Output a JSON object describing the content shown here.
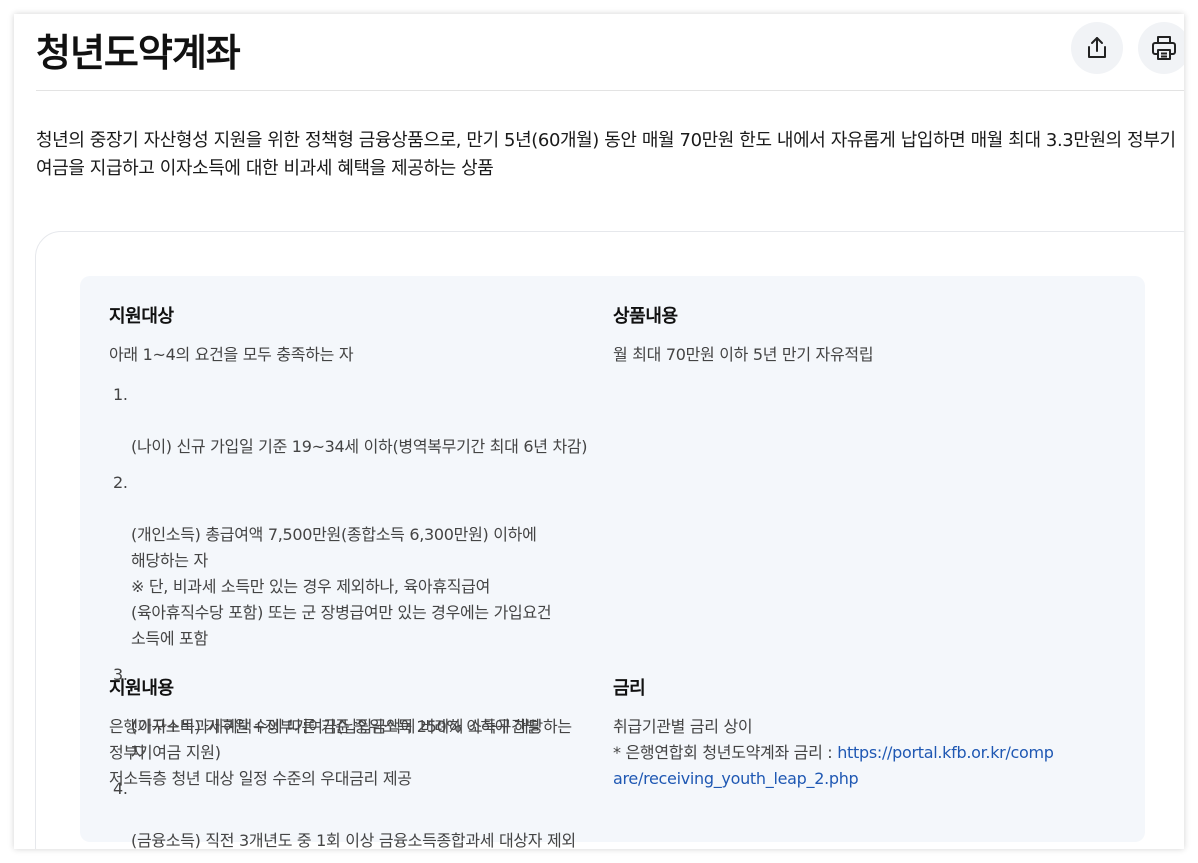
{
  "header": {
    "title": "청년도약계좌"
  },
  "description": "청년의 중장기 자산형성 지원을 위한 정책형 금융상품으로, 만기 5년(60개월) 동안 매월 70만원 한도 내에서 자유롭게 납입하면 매월 최대 3.3만원의 정부기여금을 지급하고 이자소득에 대한 비과세 혜택을 제공하는 상품",
  "sections": {
    "target": {
      "heading": "지원대상",
      "intro": "아래 1~4의 요건을 모두 충족하는 자",
      "criteria": [
        {
          "num": "1.",
          "text": "(나이) 신규 가입일 기준 19~34세 이하(병역복무기간 최대 6년 차감)"
        },
        {
          "num": "2.",
          "text": "(개인소득) 총급여액 7,500만원(종합소득 6,300만원) 이하에\n해당하는 자\n※ 단, 비과세 소득만 있는 경우 제외하나, 육아휴직급여\n(육아휴직수당 포함) 또는 군 장병급여만 있는 경우에는 가입요건\n소득에 포함"
        },
        {
          "num": "3.",
          "text": "(가구소득) 가구원 수에 따른 기준 중위소득 250% 이하에 해당하는\n자"
        },
        {
          "num": "4.",
          "text": "(금융소득) 직전 3개년도 중 1회 이상 금융소득종합과세 대상자 제외"
        }
      ]
    },
    "product": {
      "heading": "상품내용",
      "text": "월 최대 70만원 이하 5년 만기 자유적립"
    },
    "support": {
      "heading": "지원내용",
      "text": "은행이자+비과세혜택+정부기여금(납입금액에 비례해 소득구간별\n정부기여금 지원)\n저소득층 청년 대상 일정 수준의 우대금리 제공"
    },
    "rate": {
      "heading": "금리",
      "line1": "취급기관별 금리 상이",
      "note_prefix": "* 은행연합회 청년도약계좌 금리 : ",
      "link_part1": "https://portal.kfb.or.kr/comp",
      "link_part2": "are/receiving_youth_leap_2.php"
    }
  },
  "icons": {
    "share": "share-icon",
    "print": "print-icon"
  },
  "colors": {
    "link": "#1f58b3",
    "info_box_bg": "#f4f7fb",
    "icon_button_bg": "#f1f3f6"
  }
}
